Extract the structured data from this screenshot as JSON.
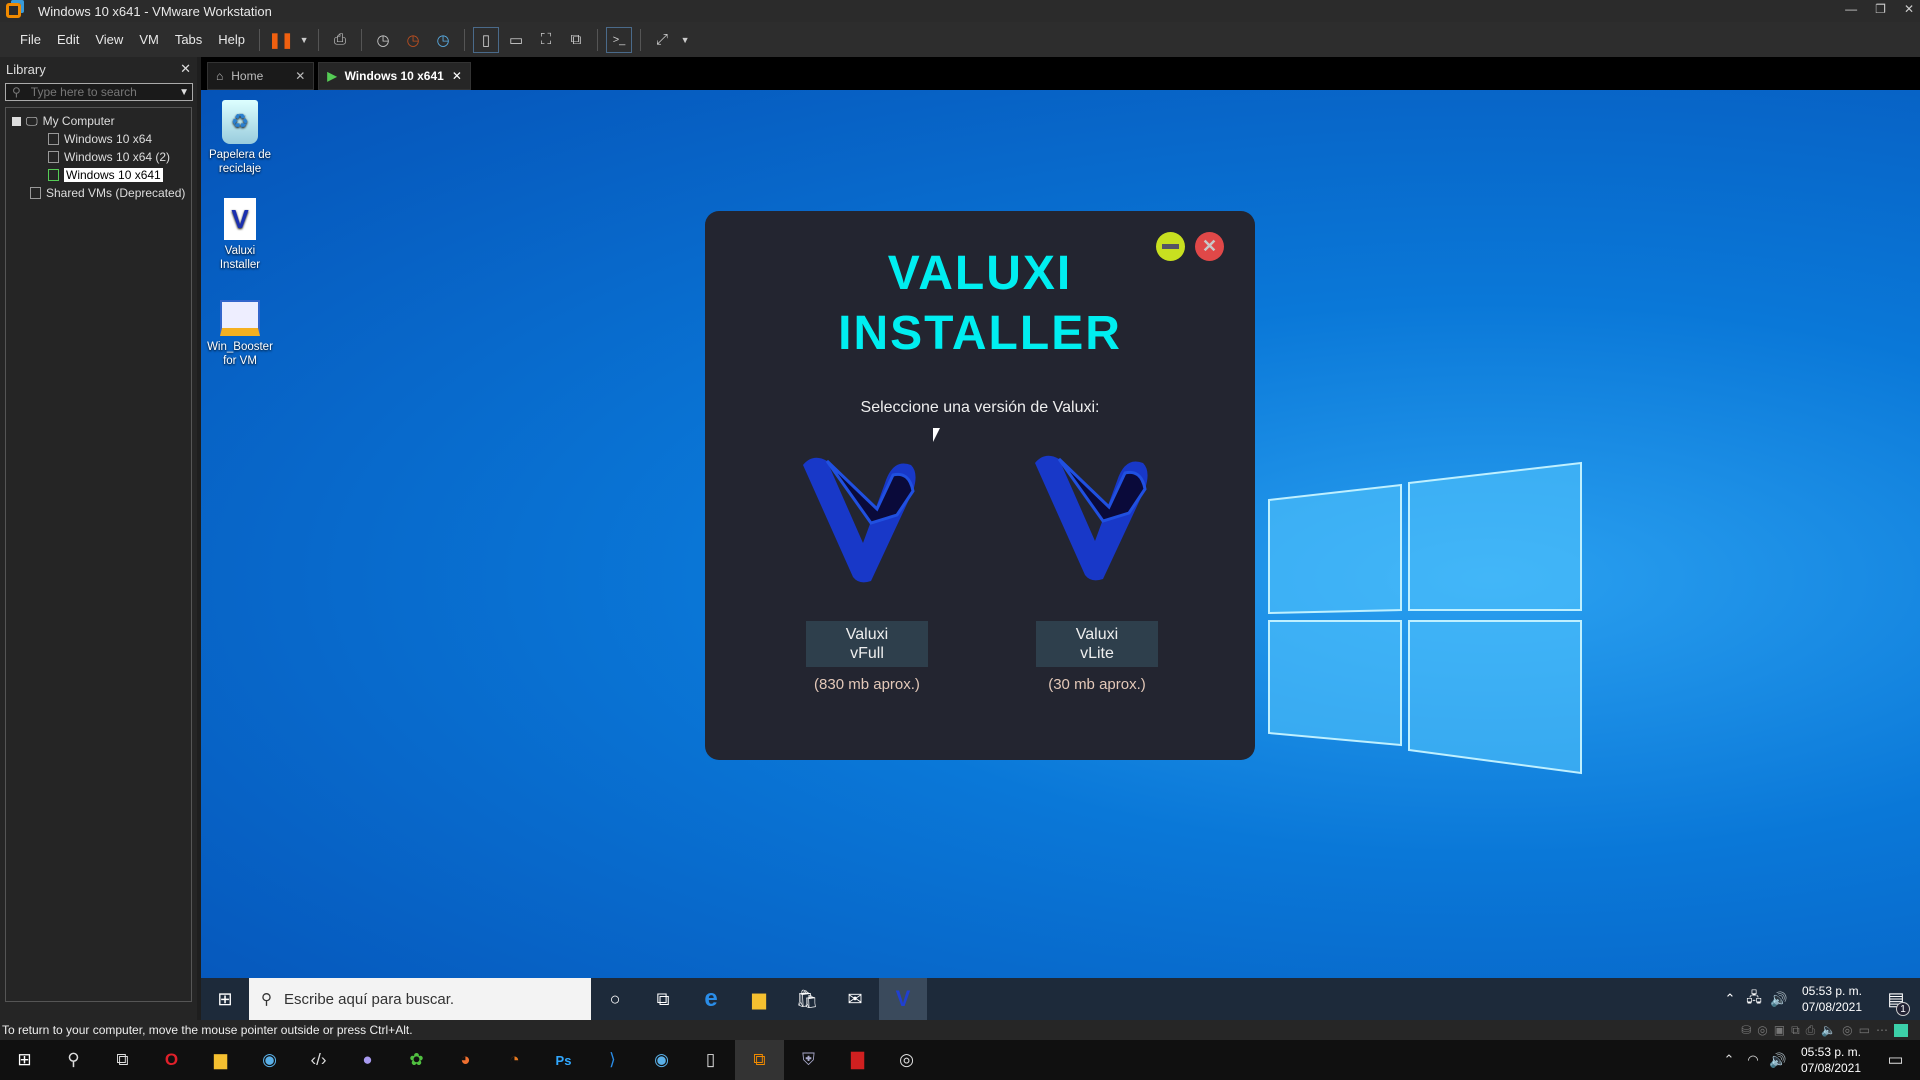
{
  "window": {
    "title": "Windows 10 x641 - VMware Workstation"
  },
  "menu": [
    "File",
    "Edit",
    "View",
    "VM",
    "Tabs",
    "Help"
  ],
  "library": {
    "title": "Library",
    "search_placeholder": "Type here to search",
    "tree": {
      "root": "My Computer",
      "vms": [
        "Windows 10 x64",
        "Windows 10 x64 (2)",
        "Windows 10 x641"
      ],
      "shared": "Shared VMs (Deprecated)"
    }
  },
  "tabs": [
    {
      "label": "Home"
    },
    {
      "label": "Windows 10 x641"
    }
  ],
  "desktop": {
    "icons": [
      {
        "label": "Papelera de reciclaje",
        "icon": "recycle-bin"
      },
      {
        "label": "Valuxi Installer",
        "icon": "valuxi"
      },
      {
        "label": "Win_Booster for VM",
        "icon": "booster"
      }
    ]
  },
  "dialog": {
    "title1": "VALUXI",
    "title2": "INSTALLER",
    "subtitle": "Seleccione una versión de Valuxi:",
    "options": [
      {
        "line1": "Valuxi",
        "line2": "vFull",
        "size": "(830 mb aprox.)"
      },
      {
        "line1": "Valuxi",
        "line2": "vLite",
        "size": "(30 mb aprox.)"
      }
    ],
    "colors": {
      "title": "#00eef0",
      "min": "#c8e020",
      "close": "#e04848"
    }
  },
  "guest_taskbar": {
    "search_placeholder": "Escribe aquí para buscar.",
    "time": "05:53 p. m.",
    "date": "07/08/2021",
    "notifications": "1"
  },
  "status": "To return to your computer, move the mouse pointer outside or press Ctrl+Alt.",
  "host_taskbar": {
    "time": "05:53 p. m.",
    "date": "07/08/2021"
  }
}
